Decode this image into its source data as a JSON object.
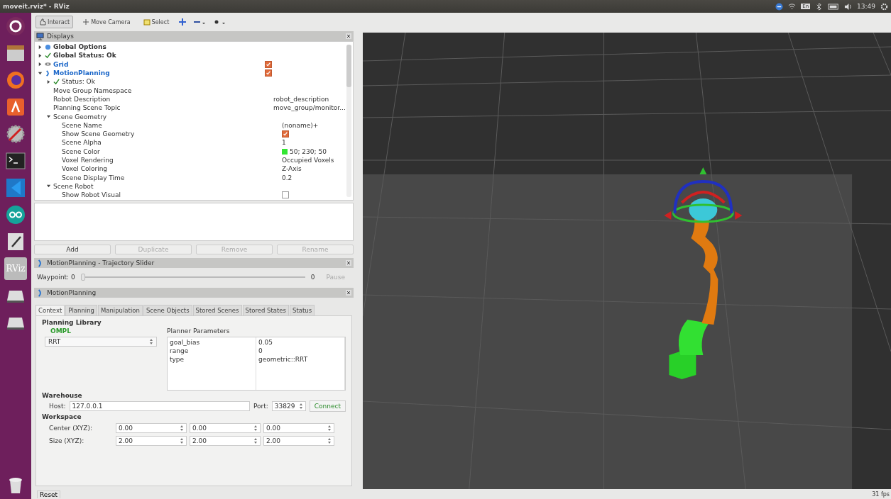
{
  "window": {
    "title": "moveit.rviz* - RViz"
  },
  "top_panel": {
    "keyboard": "En",
    "clock": "13:49"
  },
  "launcher": [
    {
      "kind": "ubuntu"
    },
    {
      "kind": "files"
    },
    {
      "kind": "firefox"
    },
    {
      "kind": "software"
    },
    {
      "kind": "settings"
    },
    {
      "kind": "terminal"
    },
    {
      "kind": "vscode"
    },
    {
      "kind": "arduino"
    },
    {
      "kind": "editor"
    },
    {
      "kind": "rviz",
      "label": "RViz",
      "selected": true
    },
    {
      "kind": "drive"
    },
    {
      "kind": "drive"
    },
    {
      "kind": "trash"
    }
  ],
  "toolbar": [
    {
      "kind": "tool",
      "label": "Interact",
      "selected": true
    },
    {
      "kind": "tool",
      "label": "Move Camera",
      "selected": false
    },
    {
      "kind": "tool",
      "label": "Select",
      "selected": false
    },
    {
      "kind": "crosshair"
    },
    {
      "kind": "measure"
    },
    {
      "kind": "point"
    }
  ],
  "displays": {
    "title": "Displays",
    "tree": [
      {
        "label": "Global Options",
        "kind": "options",
        "expanded": false
      },
      {
        "label": "Global Status: Ok",
        "kind": "status",
        "expanded": false
      },
      {
        "label": "Grid",
        "kind": "grid",
        "expanded": false,
        "checked": true
      },
      {
        "label": "MotionPlanning",
        "kind": "plugin",
        "expanded": true,
        "checked": true,
        "children": [
          {
            "label": "Status: Ok",
            "kind": "status",
            "expanded": false
          },
          {
            "label": "Move Group Namespace",
            "kind": "value"
          },
          {
            "label": "Robot Description",
            "kind": "value",
            "value": "robot_description"
          },
          {
            "label": "Planning Scene Topic",
            "kind": "value",
            "value": "move_group/monitor..."
          },
          {
            "label": "Scene Geometry",
            "kind": "group",
            "expanded": true,
            "children": [
              {
                "label": "Scene Name",
                "kind": "value",
                "value": "(noname)+"
              },
              {
                "label": "Show Scene Geometry",
                "kind": "checkbox",
                "checked": true
              },
              {
                "label": "Scene Alpha",
                "kind": "value",
                "value": "1"
              },
              {
                "label": "Scene Color",
                "kind": "color",
                "value": "50; 230; 50",
                "color": "#32e632"
              },
              {
                "label": "Voxel Rendering",
                "kind": "value",
                "value": "Occupied Voxels"
              },
              {
                "label": "Voxel Coloring",
                "kind": "value",
                "value": "Z-Axis"
              },
              {
                "label": "Scene Display Time",
                "kind": "value",
                "value": "0.2"
              }
            ]
          },
          {
            "label": "Scene Robot",
            "kind": "group",
            "expanded": true,
            "children": [
              {
                "label": "Show Robot Visual",
                "kind": "checkbox",
                "checked": false
              }
            ]
          }
        ]
      }
    ],
    "buttons": [
      {
        "label": "Add",
        "disabled": false
      },
      {
        "label": "Duplicate",
        "disabled": true
      },
      {
        "label": "Remove",
        "disabled": true
      },
      {
        "label": "Rename",
        "disabled": true
      }
    ]
  },
  "trajectory_slider": {
    "title": "MotionPlanning - Trajectory Slider",
    "waypoint": "Waypoint: 0",
    "level": 0,
    "end": "0",
    "pause": {
      "label": "Pause",
      "disabled": true
    }
  },
  "motion_planning": {
    "title": "MotionPlanning",
    "tabs": [
      {
        "label": "Context",
        "selected": true
      },
      {
        "label": "Planning",
        "selected": false
      },
      {
        "label": "Manipulation",
        "selected": false
      },
      {
        "label": "Scene Objects",
        "selected": false
      },
      {
        "label": "Stored Scenes",
        "selected": false
      },
      {
        "label": "Stored States",
        "selected": false
      },
      {
        "label": "Status",
        "selected": false
      }
    ],
    "planning_library": {
      "title": "Planning Library",
      "library": "OMPL",
      "planner": "RRT",
      "parameters_title": "Planner Parameters",
      "parameters": [
        {
          "name": "goal_bias",
          "value": "0.05"
        },
        {
          "name": "range",
          "value": "0"
        },
        {
          "name": "type",
          "value": "geometric::RRT"
        }
      ]
    },
    "warehouse": {
      "title": "Warehouse",
      "host_label": "Host:",
      "host": "127.0.0.1",
      "port_label": "Port:",
      "port": "33829",
      "connect": "Connect"
    },
    "workspace": {
      "title": "Workspace",
      "rows": [
        {
          "label": "Center (XYZ):",
          "values": [
            "0.00",
            "0.00",
            "0.00"
          ]
        },
        {
          "label": "Size (XYZ):",
          "values": [
            "2.00",
            "2.00",
            "2.00"
          ]
        }
      ]
    }
  },
  "status_bar": {
    "reset": "Reset",
    "fps": "31 fps"
  }
}
